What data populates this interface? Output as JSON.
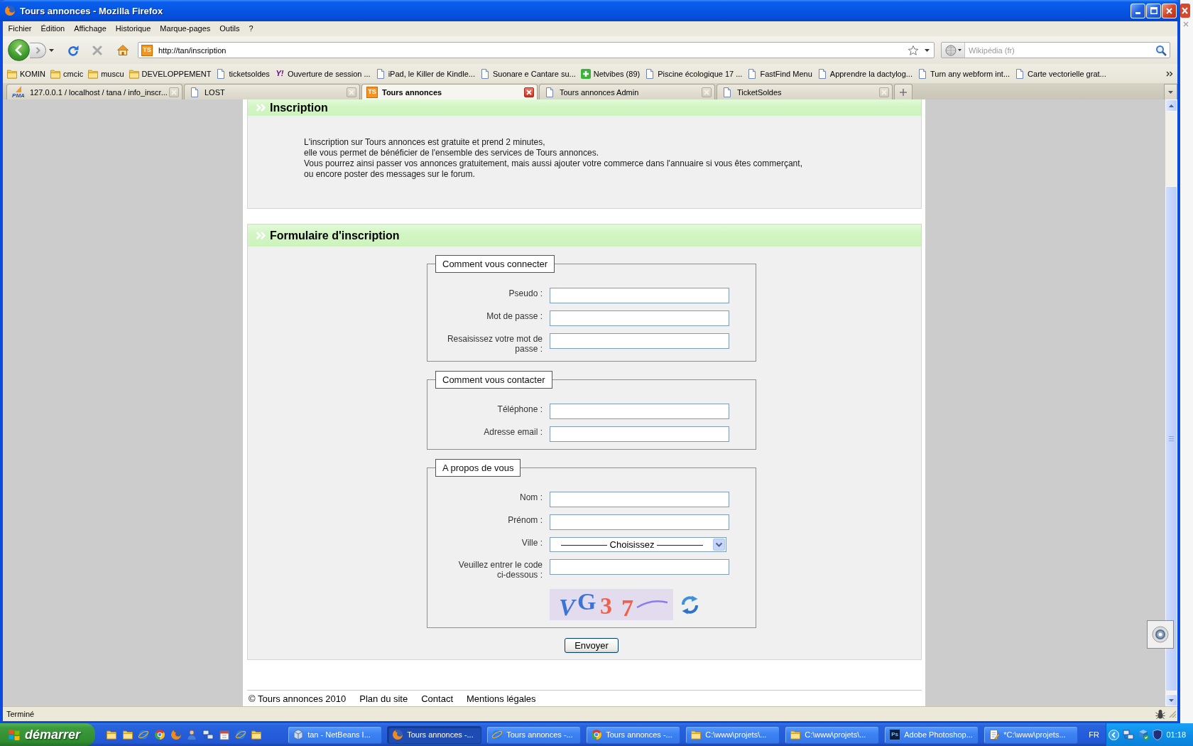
{
  "window": {
    "title": "Tours annonces - Mozilla Firefox"
  },
  "menu": [
    "Fichier",
    "Édition",
    "Affichage",
    "Historique",
    "Marque-pages",
    "Outils",
    "?"
  ],
  "navigation": {
    "site_icon_text": "TS",
    "url": "http://tan/inscription",
    "search": {
      "placeholder": "Wikipédia (fr)"
    }
  },
  "bookmarks": [
    {
      "label": "KOMIN",
      "kind": "folder"
    },
    {
      "label": "cmcic",
      "kind": "folder"
    },
    {
      "label": "muscu",
      "kind": "folder"
    },
    {
      "label": "DEVELOPPEMENT",
      "kind": "folder"
    },
    {
      "label": "ticketsoldes",
      "kind": "page"
    },
    {
      "label": "Ouverture de session ...",
      "kind": "letters",
      "icon_text": "Y!"
    },
    {
      "label": "iPad, le Killer de Kindle...",
      "kind": "page"
    },
    {
      "label": "Suonare e Cantare su...",
      "kind": "page"
    },
    {
      "label": "Netvibes (89)",
      "kind": "plus"
    },
    {
      "label": "Piscine écologique 17 ...",
      "kind": "page"
    },
    {
      "label": "FastFind Menu",
      "kind": "page"
    },
    {
      "label": "Apprendre la dactylog...",
      "kind": "page"
    },
    {
      "label": "Turn any webform int...",
      "kind": "page"
    },
    {
      "label": "Carte vectorielle grat...",
      "kind": "page"
    }
  ],
  "tabs": [
    {
      "label": "127.0.0.1 / localhost / tana / info_inscr...",
      "kind": "sail",
      "icon_text": "PMA",
      "selected": false
    },
    {
      "label": "LOST",
      "kind": "page",
      "selected": false
    },
    {
      "label": "Tours annonces",
      "kind": "tile",
      "icon_text": "TS",
      "selected": true
    },
    {
      "label": "Tours annonces Admin",
      "kind": "page",
      "selected": false
    },
    {
      "label": "TicketSoldes",
      "kind": "page",
      "selected": false
    }
  ],
  "page": {
    "intro": {
      "title": "Inscription",
      "lines": [
        "L'inscription sur Tours annonces est gratuite et prend 2 minutes,",
        "elle vous permet de bénéficier de l'ensemble des services de Tours annonces.",
        "Vous pourrez ainsi passer vos annonces gratuitement, mais aussi ajouter votre commerce dans l'annuaire si vous êtes commerçant,",
        "ou encore poster des messages sur le forum."
      ]
    },
    "form": {
      "title": "Formulaire d'inscription",
      "fieldsets": [
        {
          "legend": "Comment vous connecter",
          "fields": [
            {
              "label": "Pseudo :",
              "kind": "text"
            },
            {
              "label": "Mot de passe :",
              "kind": "text"
            },
            {
              "label": "Resaisissez votre mot de passe :",
              "kind": "text"
            }
          ]
        },
        {
          "legend": "Comment vous contacter",
          "fields": [
            {
              "label": "Téléphone :",
              "kind": "text"
            },
            {
              "label": "Adresse email :",
              "kind": "text"
            }
          ]
        },
        {
          "legend": "A propos de vous",
          "fields": [
            {
              "label": "Nom :",
              "kind": "text"
            },
            {
              "label": "Prénom :",
              "kind": "text"
            },
            {
              "label": "Ville :",
              "kind": "select",
              "value": "————— Choisissez —————"
            },
            {
              "label": "Veuillez entrer le code ci-dessous :",
              "kind": "text"
            },
            {
              "kind": "captcha",
              "characters": [
                {
                  "char": "V",
                  "color": "#3a74d6"
                },
                {
                  "char": "G",
                  "color": "#3a74d6"
                },
                {
                  "char": "3",
                  "color": "#f0604a"
                },
                {
                  "char": "7",
                  "color": "#f0604a"
                }
              ]
            }
          ]
        }
      ],
      "submit": "Envoyer"
    },
    "footer": {
      "copyright": "© Tours annonces 2010",
      "links": [
        "Plan du site",
        "Contact",
        "Mentions légales"
      ]
    }
  },
  "status_bar": {
    "text": "Terminé"
  },
  "taskbar": {
    "start": "démarrer",
    "tasks": [
      {
        "label": "tan - NetBeans I...",
        "kind": "cube",
        "selected": false
      },
      {
        "label": "Tours annonces -...",
        "kind": "globe",
        "selected": true
      },
      {
        "label": "Tours annonces -...",
        "kind": "orbit",
        "selected": false
      },
      {
        "label": "Tours annonces -...",
        "kind": "segments",
        "selected": false
      },
      {
        "label": "C:\\www\\projets\\...",
        "kind": "folder",
        "selected": false
      },
      {
        "label": "C:\\www\\projets\\...",
        "kind": "folder",
        "selected": false
      },
      {
        "label": "Adobe Photoshop...",
        "kind": "tile",
        "icon_text": "Ps",
        "selected": false
      },
      {
        "label": "*C:\\www\\projets...",
        "kind": "notepad",
        "selected": false
      }
    ],
    "language": "FR",
    "clock": "01:18"
  }
}
